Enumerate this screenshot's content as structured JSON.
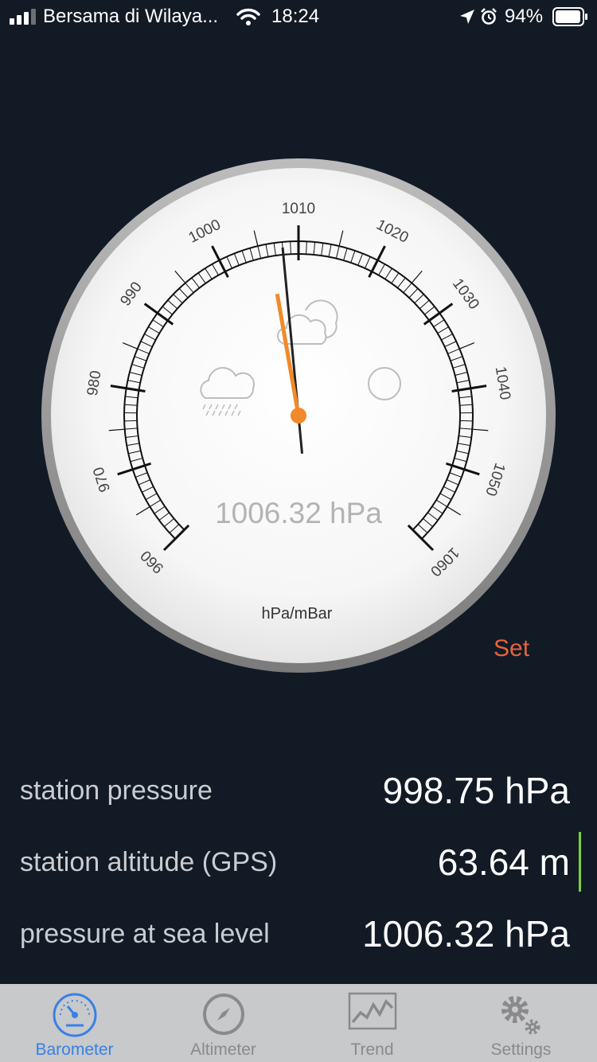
{
  "status_bar": {
    "carrier": "Bersama di Wilaya...",
    "time": "18:24",
    "battery": "94%"
  },
  "gauge": {
    "readout": "1006.32 hPa",
    "unit": "hPa/mBar",
    "ticks": [
      "960",
      "970",
      "980",
      "990",
      "1000",
      "1010",
      "1020",
      "1030",
      "1040",
      "1050",
      "1060"
    ],
    "min": 960,
    "max": 1060,
    "needle_black_value": 1008,
    "needle_orange_value": 1006.32
  },
  "set_label": "Set",
  "readings": [
    {
      "label": "station pressure",
      "value": "998.75 hPa"
    },
    {
      "label": "station altitude (GPS)",
      "value": "63.64 m"
    },
    {
      "label": "pressure at sea level",
      "value": "1006.32 hPa"
    }
  ],
  "tabs": [
    {
      "label": "Barometer",
      "icon": "barometer-icon",
      "active": true
    },
    {
      "label": "Altimeter",
      "icon": "compass-icon",
      "active": false
    },
    {
      "label": "Trend",
      "icon": "trend-chart-icon",
      "active": false
    },
    {
      "label": "Settings",
      "icon": "gears-icon",
      "active": false
    }
  ],
  "colors": {
    "background": "#121a26",
    "accent_orange": "#e5633b",
    "tab_active": "#3880e6",
    "cursor_green": "#7fd13a"
  }
}
